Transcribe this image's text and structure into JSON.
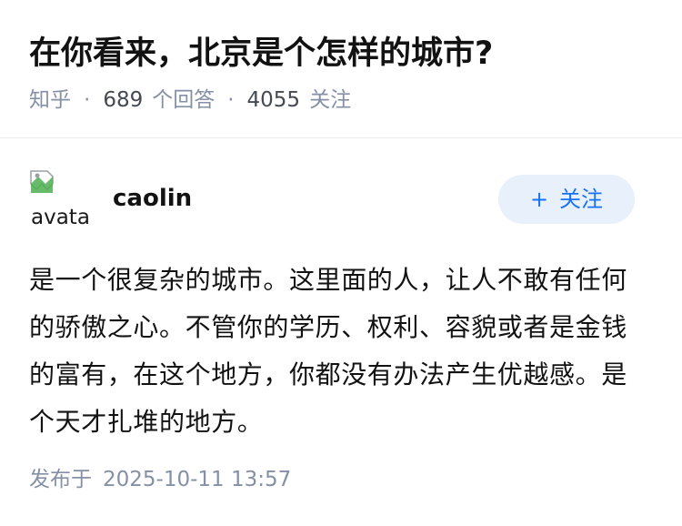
{
  "question": {
    "title": "在你看来，北京是个怎样的城市?"
  },
  "meta": {
    "source": "知乎",
    "answer_count": "689",
    "answer_label": "个回答",
    "follow_count": "4055",
    "follow_label": "关注"
  },
  "author": {
    "name": "caolin",
    "avatar_alt": "avatar",
    "follow_button": "关注",
    "follow_plus": "+"
  },
  "answer": {
    "text": "是一个很复杂的城市。这里面的人，让人不敢有任何的骄傲之心。不管你的学历、权利、容貌或者是金钱的富有，在这个地方，你都没有办法产生优越感。是个天才扎堆的地方。"
  },
  "footer": {
    "published_label": "发布于",
    "published_time": "2025-10-11 13:57"
  },
  "colors": {
    "accent": "#1772f6",
    "button_bg": "#e8f0fb",
    "meta_gray": "#8590a6",
    "text": "#121212"
  }
}
